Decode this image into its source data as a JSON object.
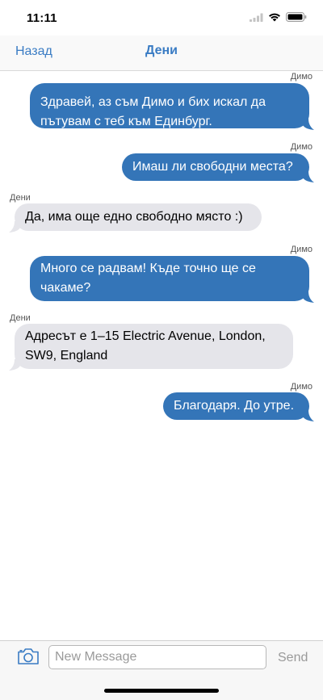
{
  "status_bar": {
    "time": "11:11"
  },
  "navbar": {
    "back_label": "Назад",
    "title": "Дени"
  },
  "messages": [
    {
      "sender": "Димо",
      "direction": "out",
      "lines": [
        "Здравей, аз съм Димо и бих искал да",
        "пътувам с теб към Единбург."
      ]
    },
    {
      "sender": "Димо",
      "direction": "out",
      "lines": [
        "Имаш ли свободни места?"
      ]
    },
    {
      "sender": "Дени",
      "direction": "in",
      "lines": [
        "Да, има още едно свободно място :)"
      ]
    },
    {
      "sender": "Димо",
      "direction": "out",
      "lines": [
        "Много се радвам! Къде точно ще се",
        "чакаме?"
      ]
    },
    {
      "sender": "Дени",
      "direction": "in",
      "lines": [
        "Адресът е 1–15 Electric Avenue, London,",
        "SW9, England"
      ]
    },
    {
      "sender": "Димо",
      "direction": "out",
      "lines": [
        "Благодаря. До утре."
      ]
    }
  ],
  "composer": {
    "placeholder": "New Message",
    "send_label": "Send"
  },
  "colors": {
    "outgoing": "#3475b8",
    "incoming": "#e5e5ea",
    "accent": "#3a7cc4"
  },
  "icons": {
    "camera": "camera-icon",
    "wifi": "wifi-icon",
    "signal": "signal-icon",
    "battery": "battery-icon"
  }
}
